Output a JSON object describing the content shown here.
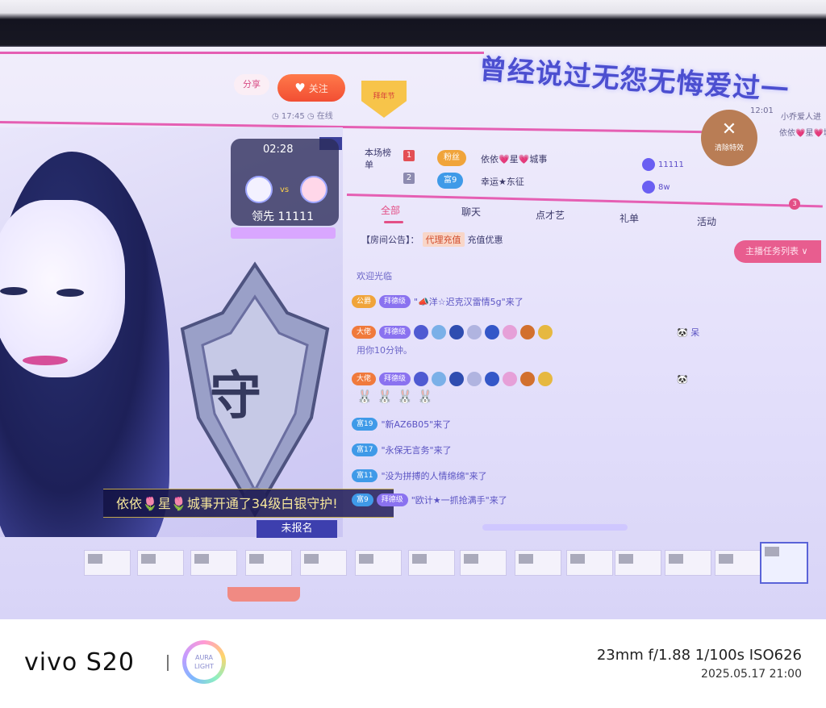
{
  "header": {
    "banner": "曾经说过无怨无悔爱过一",
    "share": "分享",
    "follow": "关注",
    "badge": "拜年节",
    "stat": "◷ 17:45  ◷ 在线",
    "close_label": "清除特效",
    "corner_lines": [
      "12:01",
      "小乔爱人进",
      "依依💗星💗城事"
    ]
  },
  "pk": {
    "timer": "02:28",
    "vs": "vs",
    "lead": "领先  11111"
  },
  "rank": {
    "title": "本场榜单",
    "rows": [
      {
        "num": "1",
        "level": "粉丝",
        "name": "依依💗星💗城事",
        "score": "11111"
      },
      {
        "num": "2",
        "level": "富9",
        "name": "幸运★东征",
        "score": "8w"
      }
    ]
  },
  "tabs": [
    "全部",
    "聊天",
    "点才艺",
    "礼单",
    "活动"
  ],
  "tab_badge": "3",
  "notice": {
    "label": "【房间公告】：",
    "chip": "代理充值",
    "text": "充值优惠"
  },
  "task_button": "主播任务列表 ∨",
  "chat": {
    "line_top": "欢迎光临",
    "row1": {
      "level": "公爵",
      "fan": "拜德级",
      "text": "\"📣洋☆迟克汉雷情5g\"来了"
    },
    "row2": {
      "level": "大佬",
      "fan": "拜德级",
      "tail": "🐼  呆",
      "sub": "用你10分钟。"
    },
    "row3": {
      "level": "大佬",
      "fan": "拜德级",
      "tail": "🐼",
      "sub": "🐰 🐰 🐰 🐰"
    },
    "row4": {
      "level": "富19",
      "text": "\"新AZ6B05\"来了"
    },
    "row5": {
      "level": "富17",
      "text": "\"永保无言务\"来了"
    },
    "row6": {
      "level": "富11",
      "text": "\"没为拼搏的人情绵绵\"来了"
    },
    "row7": {
      "level": "富9",
      "fan": "拜德级",
      "text": "\"欧计★一抓抢满手\"来了"
    }
  },
  "toast": "依依🌷星🌷城事开通了34级白银守护!",
  "signup": "未报名",
  "camera": {
    "brand": "vivo S20",
    "aura_line1": "AURA",
    "aura_line2": "LIGHT",
    "exif": "23mm  f/1.88  1/100s  ISO626",
    "datetime": "2025.05.17 21:00"
  },
  "colors": {
    "accent_pink": "#e34f86",
    "follow_orange": "#f24e33",
    "screen_tint": "#d6d2f4"
  }
}
